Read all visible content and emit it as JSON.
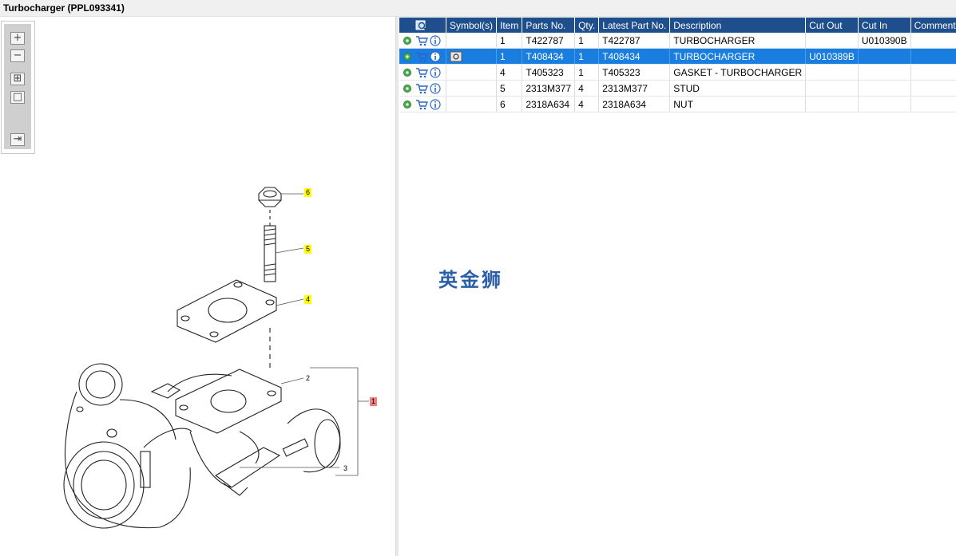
{
  "window": {
    "title": "Turbocharger (PPL093341)"
  },
  "toolbox": {
    "buttons": [
      {
        "name": "zoom-in",
        "glyph": "+"
      },
      {
        "name": "zoom-out",
        "glyph": "−"
      },
      {
        "name": "fit",
        "glyph": "⊞"
      },
      {
        "name": "actual-size",
        "glyph": "□"
      },
      {
        "name": "panel-toggle",
        "glyph": "⇥"
      }
    ]
  },
  "diagram": {
    "callouts": [
      {
        "label": "6",
        "highlight": "yellow"
      },
      {
        "label": "5",
        "highlight": "yellow"
      },
      {
        "label": "4",
        "highlight": "yellow"
      },
      {
        "label": "2",
        "highlight": "none"
      },
      {
        "label": "1",
        "highlight": "red"
      },
      {
        "label": "3",
        "highlight": "none"
      }
    ]
  },
  "table": {
    "headers": [
      "",
      "Symbol(s)",
      "Item",
      "Parts No.",
      "Qty.",
      "Latest Part No.",
      "Description",
      "Cut Out",
      "Cut In",
      "Comment"
    ],
    "rows": [
      {
        "item": "1",
        "part_no": "T422787",
        "qty": "1",
        "latest": "T422787",
        "description": "TURBOCHARGER",
        "cut_out": "",
        "cut_in": "U010390B",
        "comment": "",
        "selected": false,
        "symbol": false
      },
      {
        "item": "1",
        "part_no": "T408434",
        "qty": "1",
        "latest": "T408434",
        "description": "TURBOCHARGER",
        "cut_out": "U010389B",
        "cut_in": "",
        "comment": "",
        "selected": true,
        "symbol": true
      },
      {
        "item": "4",
        "part_no": "T405323",
        "qty": "1",
        "latest": "T405323",
        "description": "GASKET - TURBOCHARGER",
        "cut_out": "",
        "cut_in": "",
        "comment": "",
        "selected": false,
        "symbol": false
      },
      {
        "item": "5",
        "part_no": "2313M377",
        "qty": "4",
        "latest": "2313M377",
        "description": "STUD",
        "cut_out": "",
        "cut_in": "",
        "comment": "",
        "selected": false,
        "symbol": false
      },
      {
        "item": "6",
        "part_no": "2318A634",
        "qty": "4",
        "latest": "2318A634",
        "description": "NUT",
        "cut_out": "",
        "cut_in": "",
        "comment": "",
        "selected": false,
        "symbol": false
      }
    ]
  },
  "watermark": "英金狮",
  "colors": {
    "header": "#1e4e8c",
    "selected_row": "#1a7de0",
    "callout_yellow": "#ffff00",
    "callout_red": "#f08080"
  }
}
